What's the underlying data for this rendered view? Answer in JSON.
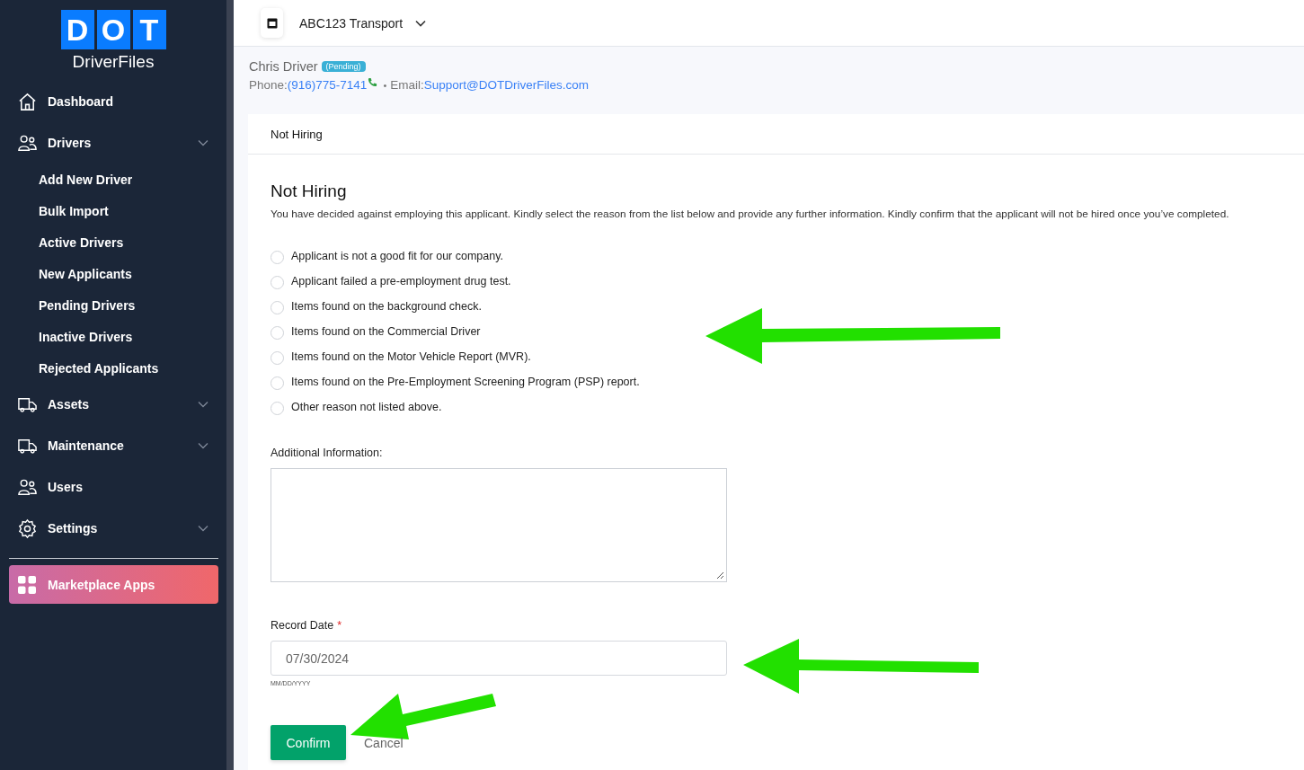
{
  "sidebar": {
    "logo": {
      "letters": [
        "D",
        "O",
        "T"
      ],
      "subtitle": "DriverFiles"
    },
    "items": [
      {
        "label": "Dashboard",
        "kind": "link"
      },
      {
        "label": "Drivers",
        "kind": "group",
        "children": [
          {
            "label": "Add New Driver"
          },
          {
            "label": "Bulk Import"
          },
          {
            "label": "Active Drivers"
          },
          {
            "label": "New Applicants"
          },
          {
            "label": "Pending Drivers"
          },
          {
            "label": "Inactive Drivers"
          },
          {
            "label": "Rejected Applicants"
          }
        ]
      },
      {
        "label": "Assets",
        "kind": "group"
      },
      {
        "label": "Maintenance",
        "kind": "group"
      },
      {
        "label": "Users",
        "kind": "link"
      },
      {
        "label": "Settings",
        "kind": "group"
      }
    ],
    "marketplace": {
      "label": "Marketplace Apps"
    }
  },
  "header": {
    "company": "ABC123 Transport"
  },
  "driver": {
    "name": "Chris Driver",
    "status": "(Pending)",
    "phone_label": "Phone:",
    "phone": "(916)775-7141",
    "separator": "•",
    "email_label": "Email:",
    "email": "Support@DOTDriverFiles.com"
  },
  "card": {
    "tab": "Not Hiring",
    "title": "Not Hiring",
    "description": "You have decided against employing this applicant. Kindly select the reason from the list below and provide any further information. Kindly confirm that the applicant will not be hired once you’ve completed.",
    "reasons": [
      {
        "label": "Applicant is not a good fit for our company.",
        "selected": false
      },
      {
        "label": "Applicant failed a pre-employment drug test.",
        "selected": false
      },
      {
        "label": "Items found on the background check.",
        "selected": false
      },
      {
        "label": "Items found on the Commercial Driver",
        "selected": false
      },
      {
        "label": "Items found on the Motor Vehicle Report (MVR).",
        "selected": false
      },
      {
        "label": "Items found on the Pre-Employment Screening Program (PSP) report.",
        "selected": false
      },
      {
        "label": "Other reason not listed above.",
        "selected": false
      }
    ],
    "additional_label": "Additional Information:",
    "record_date": {
      "label": "Record Date",
      "required_mark": "*",
      "value": "07/30/2024",
      "hint": "MM/DD/YYYY"
    },
    "buttons": {
      "confirm": "Confirm",
      "cancel": "Cancel"
    }
  }
}
